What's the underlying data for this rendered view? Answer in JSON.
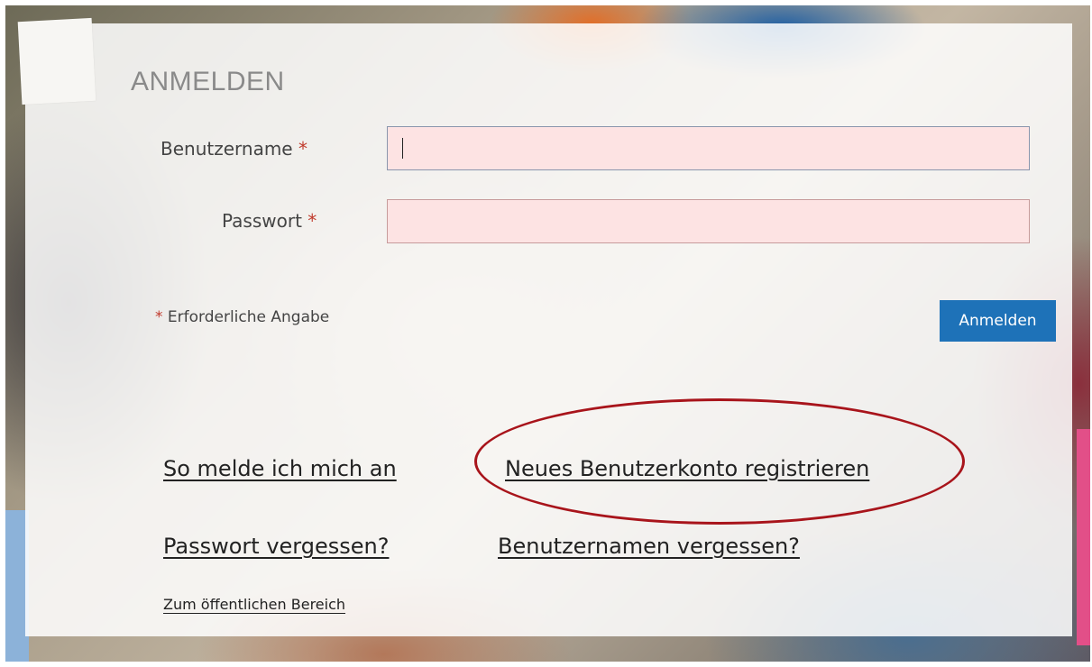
{
  "login": {
    "title": "ANMELDEN",
    "username_label": "Benutzername",
    "password_label": "Passwort",
    "required_marker": "*",
    "username_value": "",
    "password_value": "",
    "required_note": "Erforderliche Angabe",
    "submit_label": "Anmelden"
  },
  "links": {
    "how_to_login": "So melde ich mich an",
    "register": "Neues Benutzerkonto registrieren",
    "forgot_password": "Passwort vergessen?",
    "forgot_username": "Benutzernamen vergessen?",
    "public_area": "Zum öffentlichen Bereich"
  },
  "colors": {
    "button_blue": "#1e72b8",
    "required_red": "#c0392b",
    "input_error_bg": "#fde3e3",
    "annotation_red": "#a8141b"
  }
}
